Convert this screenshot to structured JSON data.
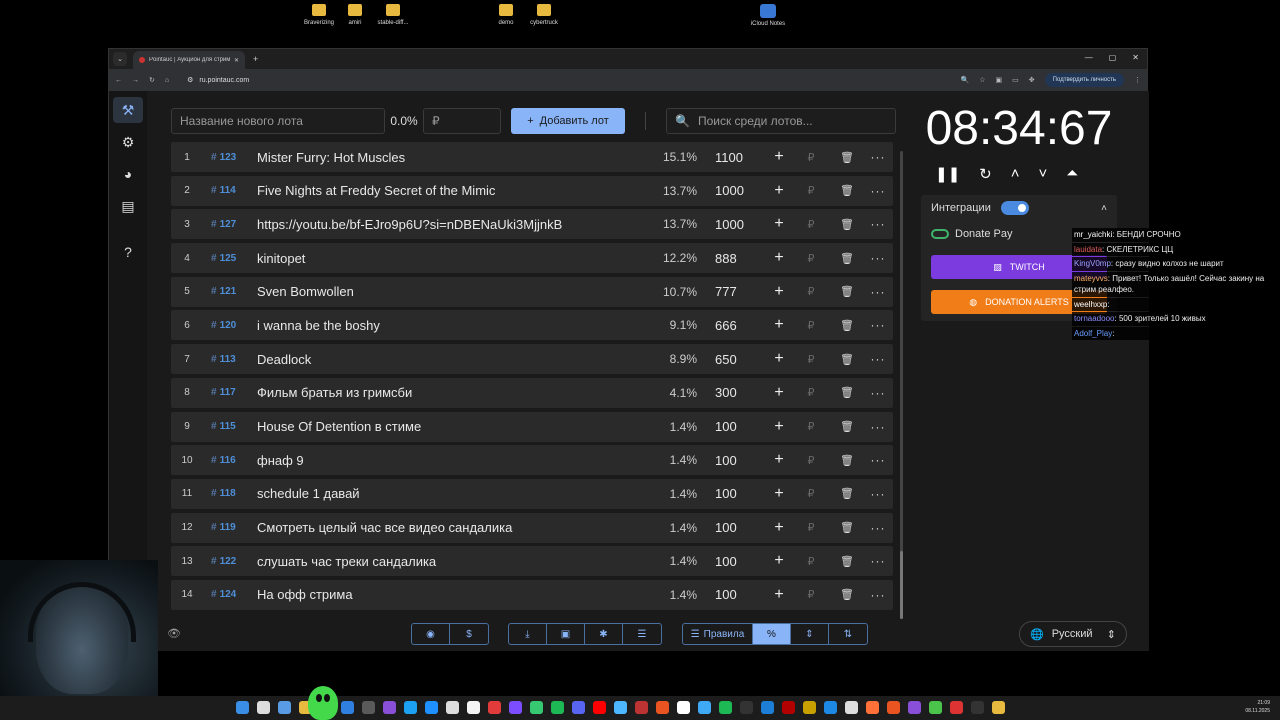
{
  "desktop": {
    "icons": [
      "Braverizing",
      "amiri",
      "stable-diff...",
      "demo",
      "cybertruck",
      "iCloud Notes"
    ]
  },
  "browser": {
    "tab_title": "Pointauc | Аукцион для стрим...",
    "url": "ru.pointauc.com",
    "verify_label": "Подтвердить личность"
  },
  "toolbar": {
    "lot_name_placeholder": "Название нового лота",
    "percent": "0.0%",
    "price_placeholder": "₽",
    "add_label": "Добавить лот",
    "search_placeholder": "Поиск среди лотов..."
  },
  "lots": [
    {
      "num": "1",
      "id": "123",
      "name": "Mister Furry: Hot Muscles",
      "pct": "15.1%",
      "amount": "1100"
    },
    {
      "num": "2",
      "id": "114",
      "name": "Five Nights at Freddy Secret of the Mimic",
      "pct": "13.7%",
      "amount": "1000"
    },
    {
      "num": "3",
      "id": "127",
      "name": "https://youtu.be/bf-EJro9p6U?si=nDBENaUki3MjjnkB",
      "pct": "13.7%",
      "amount": "1000"
    },
    {
      "num": "4",
      "id": "125",
      "name": "kinitopet",
      "pct": "12.2%",
      "amount": "888"
    },
    {
      "num": "5",
      "id": "121",
      "name": "Sven Bomwollen",
      "pct": "10.7%",
      "amount": "777"
    },
    {
      "num": "6",
      "id": "120",
      "name": "i wanna be the boshy",
      "pct": "9.1%",
      "amount": "666"
    },
    {
      "num": "7",
      "id": "113",
      "name": "Deadlock",
      "pct": "8.9%",
      "amount": "650"
    },
    {
      "num": "8",
      "id": "117",
      "name": "Фильм братья из гримсби",
      "pct": "4.1%",
      "amount": "300"
    },
    {
      "num": "9",
      "id": "115",
      "name": "House Of Detention в стиме",
      "pct": "1.4%",
      "amount": "100"
    },
    {
      "num": "10",
      "id": "116",
      "name": "фнаф 9",
      "pct": "1.4%",
      "amount": "100"
    },
    {
      "num": "11",
      "id": "118",
      "name": "schedule 1 давай",
      "pct": "1.4%",
      "amount": "100"
    },
    {
      "num": "12",
      "id": "119",
      "name": "Смотреть целый час все видео сандалика",
      "pct": "1.4%",
      "amount": "100"
    },
    {
      "num": "13",
      "id": "122",
      "name": "слушать час треки сандалика",
      "pct": "1.4%",
      "amount": "100"
    },
    {
      "num": "14",
      "id": "124",
      "name": "На офф стрима",
      "pct": "1.4%",
      "amount": "100"
    }
  ],
  "row_glyphs": {
    "hash": "#",
    "plus": "+",
    "rub": "₽",
    "trash": "🗑",
    "more": "···"
  },
  "timer": {
    "value": "08:34:67"
  },
  "integrations": {
    "title": "Интеграции",
    "donate_pay": "Donate Pay",
    "twitch": "TWITCH",
    "donation_alerts": "DONATION ALERTS"
  },
  "bottom": {
    "rules_label": "Правила",
    "percent_btn": "%"
  },
  "language": "Русский",
  "chat": [
    {
      "user": "mr_yaichki",
      "color": "#ffffff",
      "text": "БЕНДИ СРОЧНО"
    },
    {
      "user": "lauidata",
      "color": "#e05c5c",
      "text": "СКЕЛЕТРИКС ЦЦ"
    },
    {
      "user": "KingV0mp",
      "color": "#9aa0ff",
      "text": "сразу видно колхоз не шарит"
    },
    {
      "user": "mateyvvs",
      "color": "#ffb060",
      "text": "Привет! Только зашёл! Сейчас закину на стрим реалфео."
    },
    {
      "user": "weelhxxp",
      "color": "#ffffff",
      "text": ""
    },
    {
      "user": "tornaadooo",
      "color": "#8a8aff",
      "text": "500 зрителей 10 живых"
    },
    {
      "user": "Adolf_Play",
      "color": "#6a9cff",
      "text": ""
    }
  ],
  "taskbar": {
    "time": "21:09",
    "date": "08.11.2025"
  },
  "colors": {
    "accent": "#8ab4f8",
    "lot_id": "#4e8fd8",
    "twitch": "#7b3bde",
    "donation_alerts": "#f07d17"
  }
}
